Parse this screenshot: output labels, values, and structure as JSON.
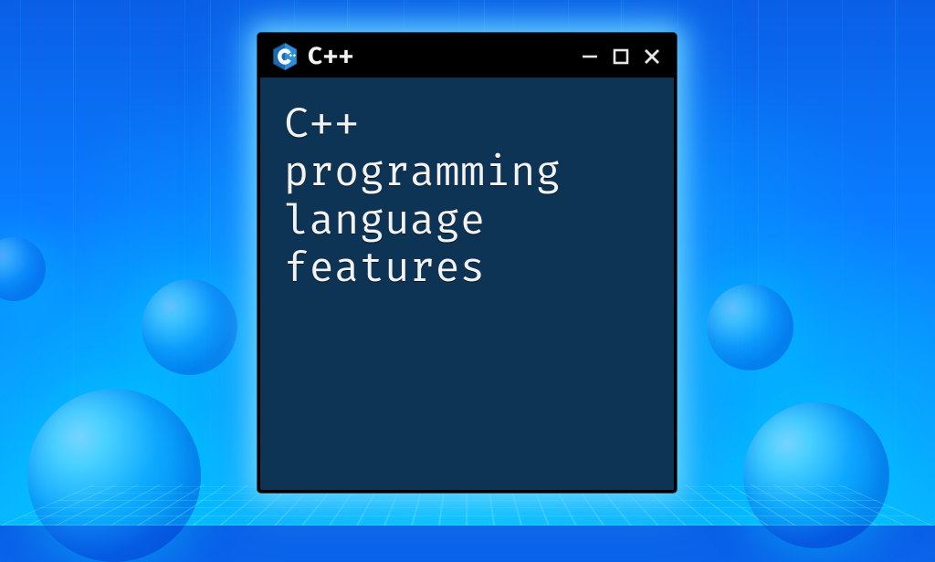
{
  "window": {
    "title": "C++",
    "icon_name": "cpp-logo-icon",
    "body_text": "C++\nprogramming\nlanguage\nfeatures",
    "colors": {
      "chrome": "#000000",
      "body_bg": "#0d3355",
      "text": "#f2f2f2",
      "icon_blue": "#1b6aae"
    }
  }
}
